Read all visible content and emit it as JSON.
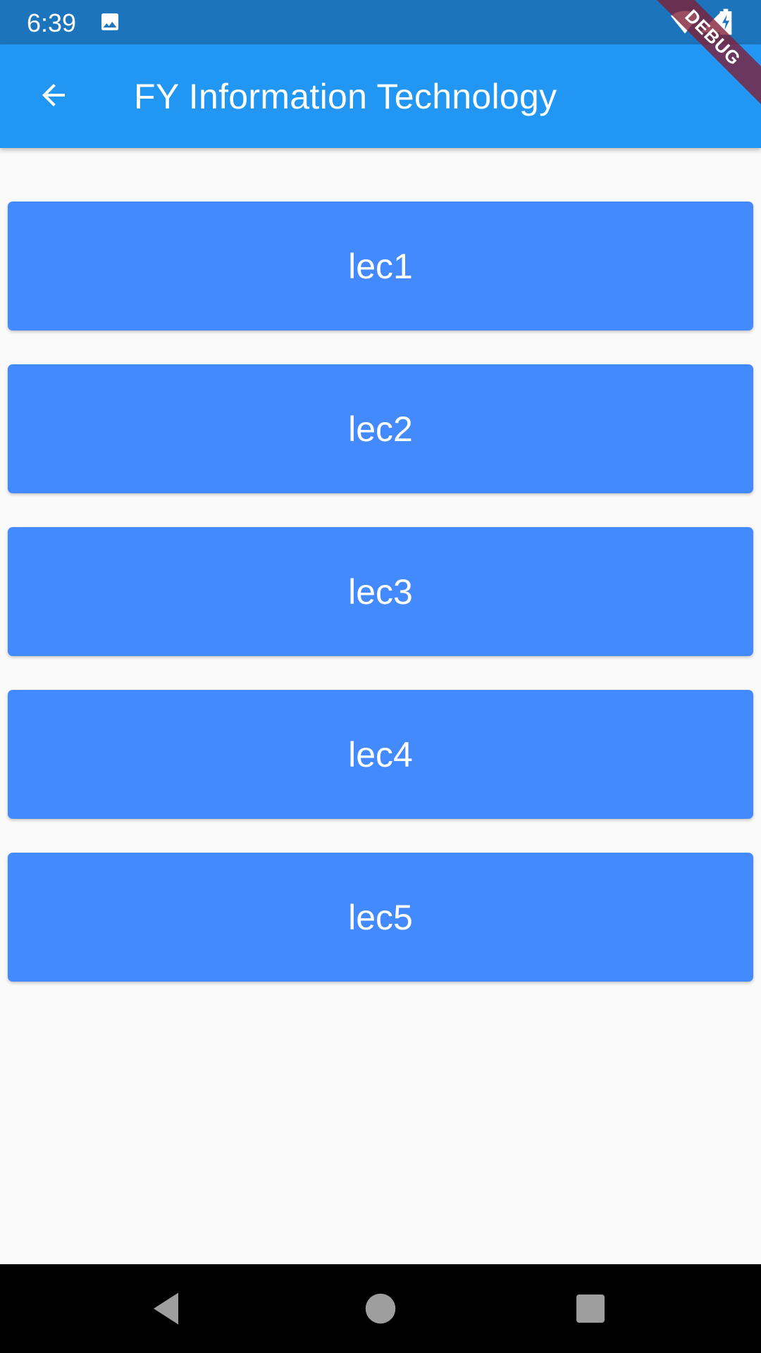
{
  "status_bar": {
    "time": "6:39",
    "icons": [
      "gallery-icon",
      "wifi-icon",
      "signal-icon",
      "battery-charging-icon"
    ]
  },
  "app_bar": {
    "title": "FY Information Technology",
    "back_icon": "arrow-left-icon",
    "color": "#2196f3"
  },
  "debug_banner": {
    "label": "DEBUG"
  },
  "lectures": [
    {
      "label": "lec1"
    },
    {
      "label": "lec2"
    },
    {
      "label": "lec3"
    },
    {
      "label": "lec4"
    },
    {
      "label": "lec5"
    }
  ],
  "colors": {
    "status_bar": "#1c75bc",
    "button": "#448aff",
    "background": "#fafafa"
  },
  "nav_bar": {
    "icons": [
      "nav-back-icon",
      "nav-home-icon",
      "nav-recents-icon"
    ]
  }
}
